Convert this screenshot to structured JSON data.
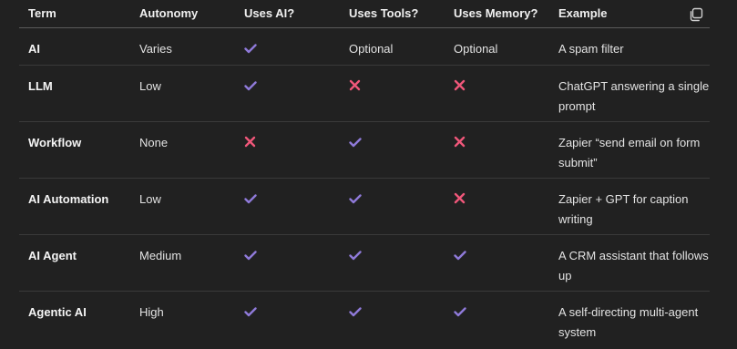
{
  "headers": [
    "Term",
    "Autonomy",
    "Uses AI?",
    "Uses Tools?",
    "Uses Memory?",
    "Example"
  ],
  "colors": {
    "check": "#8f7ad9",
    "cross": "#f0577a"
  },
  "rows": [
    {
      "term": "AI",
      "autonomy": "Varies",
      "uses_ai": {
        "type": "check"
      },
      "uses_tools": {
        "type": "text",
        "text": "Optional"
      },
      "uses_memory": {
        "type": "text",
        "text": "Optional"
      },
      "example": "A spam filter"
    },
    {
      "term": "LLM",
      "autonomy": "Low",
      "uses_ai": {
        "type": "check"
      },
      "uses_tools": {
        "type": "cross"
      },
      "uses_memory": {
        "type": "cross"
      },
      "example": "ChatGPT answering a single prompt"
    },
    {
      "term": "Workflow",
      "autonomy": "None",
      "uses_ai": {
        "type": "cross"
      },
      "uses_tools": {
        "type": "check"
      },
      "uses_memory": {
        "type": "cross"
      },
      "example": "Zapier “send email on form submit”"
    },
    {
      "term": "AI Automation",
      "autonomy": "Low",
      "uses_ai": {
        "type": "check"
      },
      "uses_tools": {
        "type": "check"
      },
      "uses_memory": {
        "type": "cross"
      },
      "example": "Zapier + GPT for caption writing"
    },
    {
      "term": "AI Agent",
      "autonomy": "Medium",
      "uses_ai": {
        "type": "check"
      },
      "uses_tools": {
        "type": "check"
      },
      "uses_memory": {
        "type": "check"
      },
      "example": "A CRM assistant that follows up"
    },
    {
      "term": "Agentic AI",
      "autonomy": "High",
      "uses_ai": {
        "type": "check"
      },
      "uses_tools": {
        "type": "check"
      },
      "uses_memory": {
        "type": "check"
      },
      "example": "A self-directing multi-agent system"
    }
  ]
}
